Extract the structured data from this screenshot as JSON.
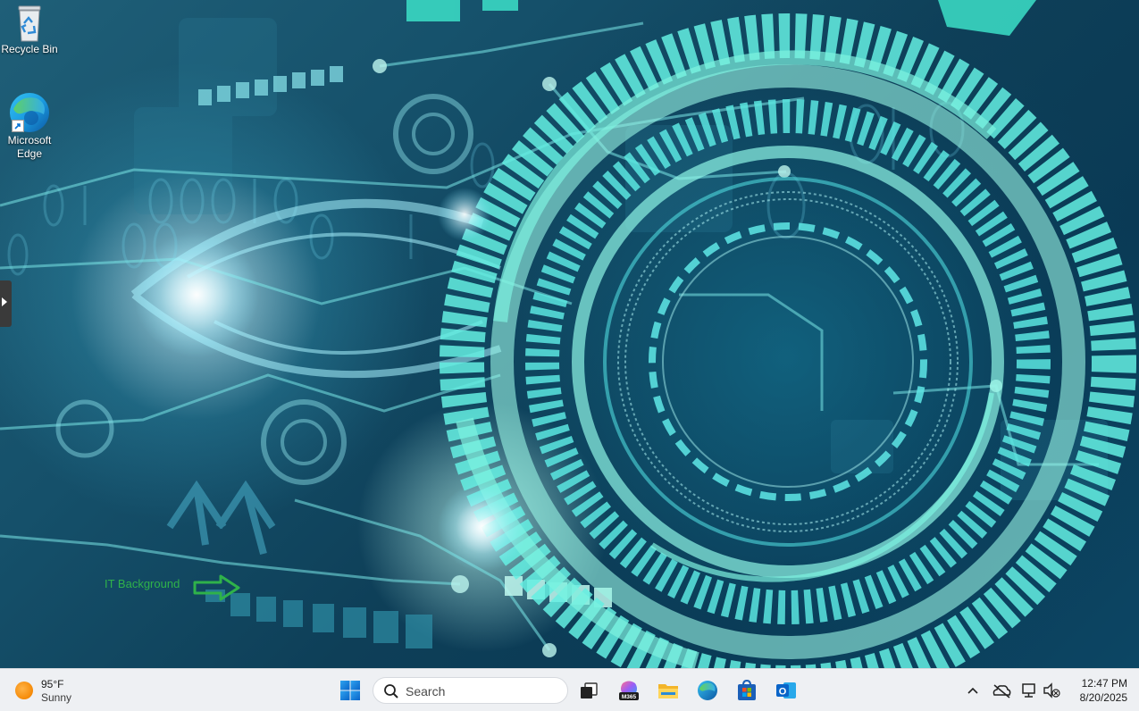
{
  "desktop": {
    "icons": [
      {
        "label": "Recycle Bin",
        "icon": "recycle-bin-icon"
      },
      {
        "label": "Microsoft Edge",
        "icon": "edge-icon"
      }
    ],
    "annotation": {
      "label": "IT Background",
      "color": "#2fb24a",
      "icon": "arrow-right-outline-icon"
    }
  },
  "taskbar": {
    "weather": {
      "temperature": "95°F",
      "condition": "Sunny",
      "icon": "sun-icon"
    },
    "start_icon": "windows-logo-icon",
    "search": {
      "placeholder": "Search",
      "icon": "search-icon"
    },
    "pinned_apps": [
      {
        "name": "task-view",
        "icon": "task-view-icon"
      },
      {
        "name": "microsoft-365",
        "icon": "m365-icon",
        "badge": "M365"
      },
      {
        "name": "file-explorer",
        "icon": "folder-icon"
      },
      {
        "name": "microsoft-edge",
        "icon": "edge-icon"
      },
      {
        "name": "microsoft-store",
        "icon": "store-icon"
      },
      {
        "name": "outlook",
        "icon": "outlook-icon",
        "letter": "O"
      }
    ],
    "tray": {
      "icons": [
        "chevron-up-icon",
        "onedrive-offline-icon",
        "network-icon",
        "volume-muted-icon"
      ],
      "time": "12:47 PM",
      "date": "8/20/2025"
    }
  },
  "colors": {
    "taskbar_bg": "#eef0f3",
    "accent_blue": "#0a74d6",
    "wallpaper_teal": "#4de0d0"
  }
}
